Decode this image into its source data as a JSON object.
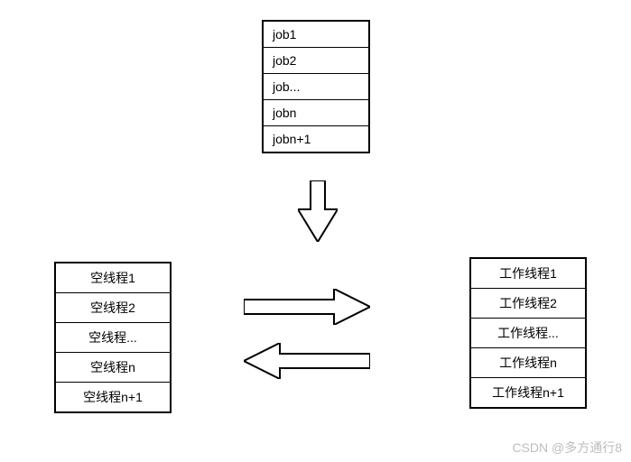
{
  "jobs": {
    "items": [
      "job1",
      "job2",
      "job...",
      "jobn",
      "jobn+1"
    ]
  },
  "idle_threads": {
    "items": [
      "空线程1",
      "空线程2",
      "空线程...",
      "空线程n",
      "空线程n+1"
    ]
  },
  "work_threads": {
    "items": [
      "工作线程1",
      "工作线程2",
      "工作线程...",
      "工作线程n",
      "工作线程n+1"
    ]
  },
  "watermark": "CSDN @多方通行8"
}
